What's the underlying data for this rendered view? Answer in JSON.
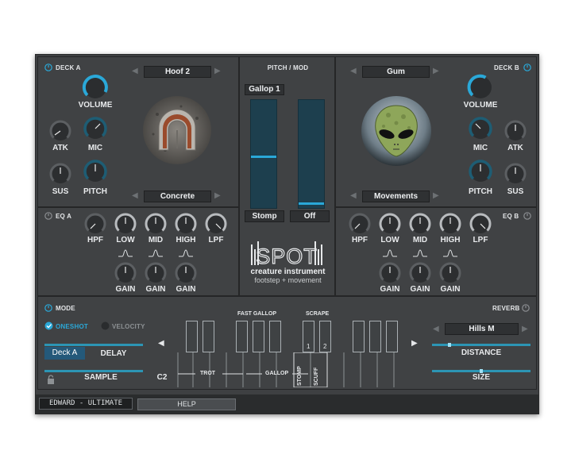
{
  "deck_a": {
    "title": "DECK A",
    "preset": "Hoof 2",
    "surface": "Concrete",
    "knobs": {
      "volume": "VOLUME",
      "atk": "ATK",
      "mic": "MIC",
      "sus": "SUS",
      "pitch": "PITCH"
    }
  },
  "deck_b": {
    "title": "DECK B",
    "preset": "Gum",
    "surface": "Movements",
    "knobs": {
      "volume": "VOLUME",
      "mic": "MIC",
      "atk": "ATK",
      "pitch": "PITCH",
      "sus": "SUS"
    }
  },
  "pitch_mod": {
    "title": "PITCH / MOD",
    "preset": "Gallop 1",
    "left_label": "Stomp",
    "right_label": "Off",
    "left_level": 0.47,
    "right_level": 0.03
  },
  "eq_a": {
    "title": "EQ A",
    "hpf": "HPF",
    "low": "LOW",
    "mid": "MID",
    "high": "HIGH",
    "lpf": "LPF",
    "gain1": "GAIN",
    "gain2": "GAIN",
    "gain3": "GAIN"
  },
  "eq_b": {
    "title": "EQ B",
    "hpf": "HPF",
    "low": "LOW",
    "mid": "MID",
    "high": "HIGH",
    "lpf": "LPF",
    "gain1": "GAIN",
    "gain2": "GAIN",
    "gain3": "GAIN"
  },
  "logo": {
    "name": "SPOT",
    "line1": "creature instrument",
    "line2": "footstep + movement"
  },
  "mode": {
    "title": "MODE",
    "oneshot": "ONESHOT",
    "velocity": "VELOCITY",
    "deck": "Deck A",
    "delay": "DELAY",
    "sample": "SAMPLE",
    "note": "C2"
  },
  "keys": {
    "fast_gallop": "FAST GALLOP",
    "scrape": "SCRAPE",
    "key1": "1",
    "key2": "2",
    "trot": "TROT",
    "gallop": "GALLOP",
    "stomp": "STOMP",
    "scuff": "SCUFF",
    "left_arrow": "◀",
    "right_arrow": "▶"
  },
  "reverb": {
    "title": "REVERB",
    "preset": "Hills M",
    "distance": "DISTANCE",
    "size": "SIZE",
    "distance_value": 0.17,
    "size_value": 0.5
  },
  "footer": {
    "preset_tab": "EDWARD - ULTIMATE",
    "help_tab": "HELP"
  },
  "colors": {
    "accent": "#2aa8d8",
    "panel": "#404244",
    "track": "#1d3f4e"
  },
  "icons": {
    "power": "power-icon",
    "lock": "lock-icon",
    "check": "check-icon"
  }
}
